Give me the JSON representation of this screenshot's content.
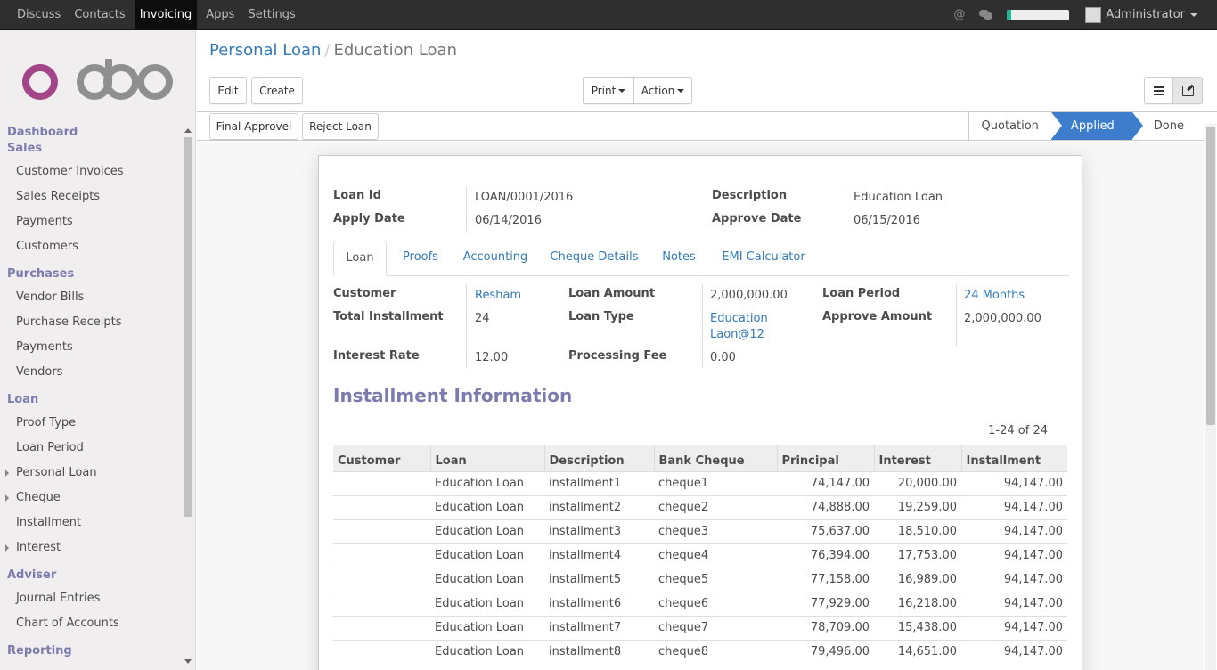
{
  "topbar": {
    "menu": [
      "Discuss",
      "Contacts",
      "Invoicing",
      "Apps",
      "Settings"
    ],
    "active_menu": "Invoicing",
    "user": "Administrator",
    "progress_fraction": 0.07,
    "accent": "#21b799"
  },
  "sidebar": {
    "logo_text": "odoo",
    "sections": {
      "dashboard": "Dashboard",
      "sales": "Sales",
      "purchases": "Purchases",
      "loan": "Loan",
      "adviser": "Adviser",
      "reporting": "Reporting"
    },
    "items": {
      "customer_invoices": "Customer Invoices",
      "sales_receipts": "Sales Receipts",
      "payments_sales": "Payments",
      "customers": "Customers",
      "vendor_bills": "Vendor Bills",
      "purchase_receipts": "Purchase Receipts",
      "payments_purchases": "Payments",
      "vendors": "Vendors",
      "proof_type": "Proof Type",
      "loan_period": "Loan Period",
      "personal_loan": "Personal Loan",
      "cheque": "Cheque",
      "installment": "Installment",
      "interest": "Interest",
      "journal_entries": "Journal Entries",
      "chart_of_accounts": "Chart of Accounts"
    }
  },
  "breadcrumb": {
    "parent": "Personal Loan",
    "separator": "/",
    "current": "Education Loan"
  },
  "buttons": {
    "edit": "Edit",
    "create": "Create",
    "print": "Print",
    "action": "Action",
    "final_approve": "Final Approvel",
    "reject_loan": "Reject Loan"
  },
  "stages": {
    "quotation": "Quotation",
    "applied": "Applied",
    "done": "Done",
    "active_color": "#3d7dcc"
  },
  "form": {
    "labels": {
      "loan_id": "Loan Id",
      "apply_date": "Apply Date",
      "description": "Description",
      "approve_date": "Approve Date",
      "customer": "Customer",
      "total_installment": "Total Installment",
      "interest_rate": "Interest Rate",
      "loan_amount": "Loan Amount",
      "loan_type": "Loan Type",
      "processing_fee": "Processing Fee",
      "loan_period": "Loan Period",
      "approve_amount": "Approve Amount"
    },
    "values": {
      "loan_id": "LOAN/0001/2016",
      "apply_date": "06/14/2016",
      "description": "Education Loan",
      "approve_date": "06/15/2016",
      "customer": "Resham",
      "total_installment": "24",
      "interest_rate": "12.00",
      "loan_amount": "2,000,000.00",
      "loan_type_line1": "Education",
      "loan_type_line2": "Laon@12",
      "processing_fee": "0.00",
      "loan_period": "24 Months",
      "approve_amount": "2,000,000.00"
    }
  },
  "tabs": [
    "Loan",
    "Proofs",
    "Accounting",
    "Cheque Details",
    "Notes",
    "EMI Calculator"
  ],
  "installments": {
    "title": "Installment Information",
    "pager": "1-24 of 24",
    "columns": [
      "Customer",
      "Loan",
      "Description",
      "Bank Cheque",
      "Principal",
      "Interest",
      "Installment"
    ],
    "rows": [
      [
        "",
        "Education Loan",
        "installment1",
        "cheque1",
        "74,147.00",
        "20,000.00",
        "94,147.00"
      ],
      [
        "",
        "Education Loan",
        "installment2",
        "cheque2",
        "74,888.00",
        "19,259.00",
        "94,147.00"
      ],
      [
        "",
        "Education Loan",
        "installment3",
        "cheque3",
        "75,637.00",
        "18,510.00",
        "94,147.00"
      ],
      [
        "",
        "Education Loan",
        "installment4",
        "cheque4",
        "76,394.00",
        "17,753.00",
        "94,147.00"
      ],
      [
        "",
        "Education Loan",
        "installment5",
        "cheque5",
        "77,158.00",
        "16,989.00",
        "94,147.00"
      ],
      [
        "",
        "Education Loan",
        "installment6",
        "cheque6",
        "77,929.00",
        "16,218.00",
        "94,147.00"
      ],
      [
        "",
        "Education Loan",
        "installment7",
        "cheque7",
        "78,709.00",
        "15,438.00",
        "94,147.00"
      ],
      [
        "",
        "Education Loan",
        "installment8",
        "cheque8",
        "79,496.00",
        "14,651.00",
        "94,147.00"
      ]
    ]
  }
}
